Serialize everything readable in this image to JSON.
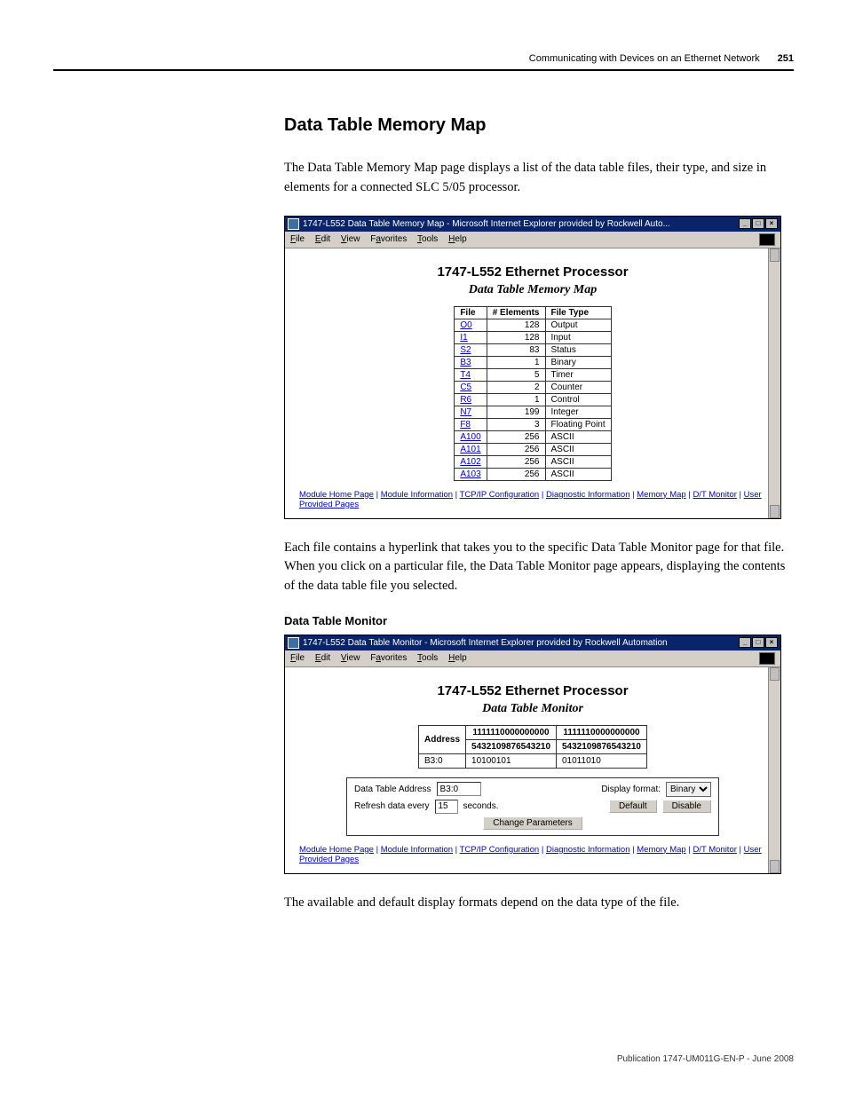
{
  "header": {
    "chapter": "Communicating with Devices on an Ethernet Network",
    "pageno": "251",
    "footer": "Publication 1747-UM011G-EN-P - June 2008"
  },
  "section": {
    "title": "Data Table Memory Map",
    "para1": "The Data Table Memory Map page displays a list of the data table files, their type, and size in elements for a connected SLC 5/05 processor.",
    "para2": "Each file contains a hyperlink that takes you to the specific Data Table Monitor page for that file. When you click on a particular file, the Data Table Monitor page appears, displaying the contents of the data table file you selected.",
    "subhead": "Data Table Monitor",
    "para3": "The available and default display formats depend on the data type of the file."
  },
  "shot1": {
    "title": "1747-L552 Data Table Memory Map - Microsoft Internet Explorer provided by Rockwell Auto...",
    "menus": {
      "file": "File",
      "edit": "Edit",
      "view": "View",
      "favorites": "Favorites",
      "tools": "Tools",
      "help": "Help"
    },
    "proc_title": "1747-L552 Ethernet Processor",
    "subtitle": "Data Table Memory Map",
    "cols": {
      "c1": "File",
      "c2": "# Elements",
      "c3": "File Type"
    },
    "rows": [
      {
        "file": "O0",
        "elems": "128",
        "type": "Output"
      },
      {
        "file": "I1",
        "elems": "128",
        "type": "Input"
      },
      {
        "file": "S2",
        "elems": "83",
        "type": "Status"
      },
      {
        "file": "B3",
        "elems": "1",
        "type": "Binary"
      },
      {
        "file": "T4",
        "elems": "5",
        "type": "Timer"
      },
      {
        "file": "C5",
        "elems": "2",
        "type": "Counter"
      },
      {
        "file": "R6",
        "elems": "1",
        "type": "Control"
      },
      {
        "file": "N7",
        "elems": "199",
        "type": "Integer"
      },
      {
        "file": "F8",
        "elems": "3",
        "type": "Floating Point"
      },
      {
        "file": "A100",
        "elems": "256",
        "type": "ASCII"
      },
      {
        "file": "A101",
        "elems": "256",
        "type": "ASCII"
      },
      {
        "file": "A102",
        "elems": "256",
        "type": "ASCII"
      },
      {
        "file": "A103",
        "elems": "256",
        "type": "ASCII"
      }
    ],
    "links": {
      "l1": "Module Home Page",
      "l2": "Module Information",
      "l3": "TCP/IP Configuration",
      "l4": "Diagnostic Information",
      "l5": "Memory Map",
      "l6": "D/T Monitor",
      "l7": "User Provided Pages"
    }
  },
  "shot2": {
    "title": "1747-L552 Data Table Monitor - Microsoft Internet Explorer provided by Rockwell Automation",
    "menus": {
      "file": "File",
      "edit": "Edit",
      "view": "View",
      "favorites": "Favorites",
      "tools": "Tools",
      "help": "Help"
    },
    "proc_title": "1747-L552 Ethernet Processor",
    "subtitle": "Data Table Monitor",
    "tbl": {
      "hdr_addr": "Address",
      "hdr_bits_a": "1111110000000000",
      "hdr_bits_b": "5432109876543210",
      "hdr_bits_c": "1111110000000000",
      "hdr_bits_d": "5432109876543210",
      "row_addr": "B3:0",
      "row_val1": "10100101",
      "row_val2": "01011010"
    },
    "controls": {
      "lbl_addr": "Data Table Address",
      "val_addr": "B3:0",
      "lbl_fmt": "Display format:",
      "val_fmt": "Binary",
      "lbl_refresh_a": "Refresh data every",
      "val_refresh": "15",
      "lbl_refresh_b": "seconds.",
      "btn_default": "Default",
      "btn_disable": "Disable",
      "btn_change": "Change Parameters"
    },
    "links": {
      "l1": "Module Home Page",
      "l2": "Module Information",
      "l3": "TCP/IP Configuration",
      "l4": "Diagnostic Information",
      "l5": "Memory Map",
      "l6": "D/T Monitor",
      "l7": "User Provided Pages"
    }
  }
}
